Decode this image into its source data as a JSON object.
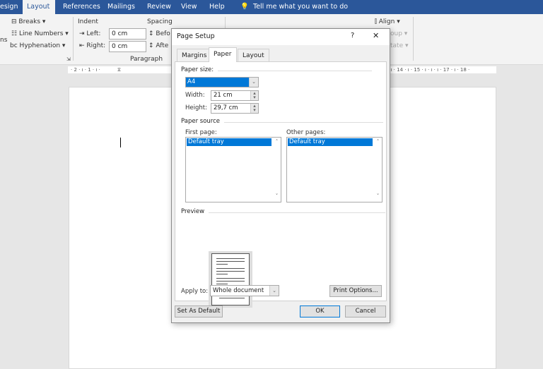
{
  "ribbon_tabs": [
    {
      "label": "esign"
    },
    {
      "label": "Layout",
      "active": true
    },
    {
      "label": "References"
    },
    {
      "label": "Mailings"
    },
    {
      "label": "Review"
    },
    {
      "label": "View"
    },
    {
      "label": "Help"
    }
  ],
  "tell_me": "Tell me what you want to do",
  "ribbon": {
    "cut_label": "ns",
    "breaks": "Breaks",
    "line_numbers": "Line Numbers",
    "hyphenation": "Hyphenation",
    "indent": "Indent",
    "left_label": "Left:",
    "left_value": "0 cm",
    "right_label": "Right:",
    "right_value": "0 cm",
    "spacing": "Spacing",
    "before": "Befo",
    "after": "Afte",
    "paragraph": "Paragraph",
    "align": "Align",
    "group": "oup",
    "rotate": "tate"
  },
  "ruler": {
    "left": "· 2 · ı · 1 · ı ·",
    "right": "· ı · 14 · ı · 15 · ı · ı · ı · 17 · ı · 18 ·"
  },
  "dialog": {
    "title": "Page Setup",
    "help": "?",
    "close": "✕",
    "tabs": [
      {
        "label": "Margins"
      },
      {
        "label": "Paper",
        "active": true
      },
      {
        "label": "Layout"
      }
    ],
    "paper_size_label": "Paper size:",
    "paper_size_value": "A4",
    "width_label": "Width:",
    "width_value": "21 cm",
    "height_label": "Height:",
    "height_value": "29,7 cm",
    "paper_source_label": "Paper source",
    "first_page_label": "First page:",
    "first_page_items": [
      "Default tray"
    ],
    "other_pages_label": "Other pages:",
    "other_pages_items": [
      "Default tray"
    ],
    "preview_label": "Preview",
    "apply_to_label": "Apply to:",
    "apply_to_value": "Whole document",
    "print_options": "Print Options...",
    "set_default": "Set As Default",
    "ok": "OK",
    "cancel": "Cancel"
  }
}
